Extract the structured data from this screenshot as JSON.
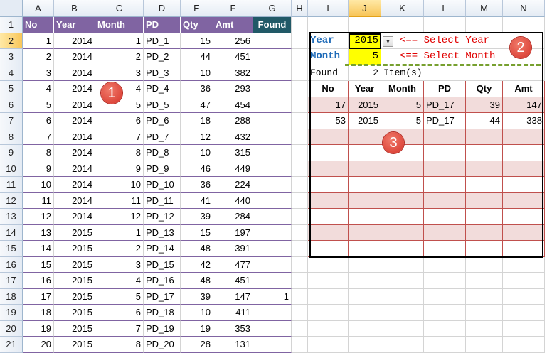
{
  "columns": [
    "A",
    "B",
    "C",
    "D",
    "E",
    "F",
    "G",
    "H",
    "I",
    "J",
    "K",
    "L",
    "M",
    "N"
  ],
  "selected_column": "J",
  "row_numbers": [
    1,
    2,
    3,
    4,
    5,
    6,
    7,
    8,
    9,
    10,
    11,
    12,
    13,
    14,
    15,
    16,
    17,
    18,
    19,
    20,
    21
  ],
  "selected_row": 2,
  "source_table": {
    "headers": [
      "No",
      "Year",
      "Month",
      "PD",
      "Qty",
      "Amt",
      "Found"
    ],
    "rows": [
      [
        "1",
        "2014",
        "1",
        "PD_1",
        "15",
        "256",
        ""
      ],
      [
        "2",
        "2014",
        "2",
        "PD_2",
        "44",
        "451",
        ""
      ],
      [
        "3",
        "2014",
        "3",
        "PD_3",
        "10",
        "382",
        ""
      ],
      [
        "4",
        "2014",
        "4",
        "PD_4",
        "36",
        "293",
        ""
      ],
      [
        "5",
        "2014",
        "5",
        "PD_5",
        "47",
        "454",
        ""
      ],
      [
        "6",
        "2014",
        "6",
        "PD_6",
        "18",
        "288",
        ""
      ],
      [
        "7",
        "2014",
        "7",
        "PD_7",
        "12",
        "432",
        ""
      ],
      [
        "8",
        "2014",
        "8",
        "PD_8",
        "10",
        "315",
        ""
      ],
      [
        "9",
        "2014",
        "9",
        "PD_9",
        "46",
        "449",
        ""
      ],
      [
        "10",
        "2014",
        "10",
        "PD_10",
        "36",
        "224",
        ""
      ],
      [
        "11",
        "2014",
        "11",
        "PD_11",
        "41",
        "440",
        ""
      ],
      [
        "12",
        "2014",
        "12",
        "PD_12",
        "39",
        "284",
        ""
      ],
      [
        "13",
        "2015",
        "1",
        "PD_13",
        "15",
        "197",
        ""
      ],
      [
        "14",
        "2015",
        "2",
        "PD_14",
        "48",
        "391",
        ""
      ],
      [
        "15",
        "2015",
        "3",
        "PD_15",
        "42",
        "477",
        ""
      ],
      [
        "16",
        "2015",
        "4",
        "PD_16",
        "48",
        "451",
        ""
      ],
      [
        "17",
        "2015",
        "5",
        "PD_17",
        "39",
        "147",
        "1"
      ],
      [
        "18",
        "2015",
        "6",
        "PD_18",
        "10",
        "411",
        ""
      ],
      [
        "19",
        "2015",
        "7",
        "PD_19",
        "19",
        "353",
        ""
      ],
      [
        "20",
        "2015",
        "8",
        "PD_20",
        "28",
        "131",
        ""
      ]
    ]
  },
  "selector": {
    "year_label": "Year",
    "year_value": "2015",
    "year_note": "<== Select Year",
    "month_label": "Month",
    "month_value": "5",
    "month_note": "<== Select Month",
    "found_label": "Found",
    "found_count": "2",
    "found_unit": "Item(s)"
  },
  "result_table": {
    "headers": [
      "No",
      "Year",
      "Month",
      "PD",
      "Qty",
      "Amt"
    ],
    "rows": [
      [
        "17",
        "2015",
        "5",
        "PD_17",
        "39",
        "147"
      ],
      [
        "53",
        "2015",
        "5",
        "PD_17",
        "44",
        "338"
      ],
      [
        "",
        "",
        "",
        "",
        "",
        ""
      ],
      [
        "",
        "",
        "",
        "",
        "",
        ""
      ],
      [
        "",
        "",
        "",
        "",
        "",
        ""
      ],
      [
        "",
        "",
        "",
        "",
        "",
        ""
      ],
      [
        "",
        "",
        "",
        "",
        "",
        ""
      ],
      [
        "",
        "",
        "",
        "",
        "",
        ""
      ],
      [
        "",
        "",
        "",
        "",
        "",
        ""
      ],
      [
        "",
        "",
        "",
        "",
        "",
        ""
      ]
    ]
  },
  "badges": [
    "1",
    "2",
    "3"
  ],
  "colors": {
    "header_purple": "#8064a2",
    "found_header": "#215967",
    "pink_band": "#f2dcdb",
    "yellow_input": "#ffff00",
    "note_red": "#e00000",
    "label_blue": "#1f6bb8",
    "badge_red": "#d6332a"
  }
}
